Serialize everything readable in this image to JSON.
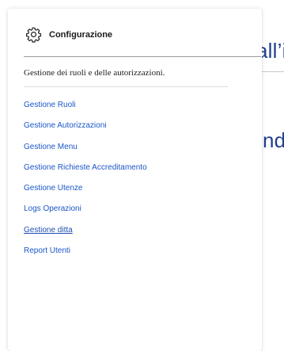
{
  "background": {
    "fragment_1": "all’i",
    "fragment_2": "indi"
  },
  "panel": {
    "icon": "gear-icon",
    "title": "Configurazione",
    "subtitle": "Gestione dei ruoli e delle autorizzazioni."
  },
  "menu": {
    "items": [
      {
        "label": "Gestione Ruoli"
      },
      {
        "label": "Gestione Autorizzazioni"
      },
      {
        "label": "Gestione Menu"
      },
      {
        "label": "Gestione Richieste Accreditamento"
      },
      {
        "label": "Gestione Utenze"
      },
      {
        "label": "Logs Operazioni"
      },
      {
        "label": "Gestione ditta"
      },
      {
        "label": "Report Utenti"
      }
    ]
  },
  "colors": {
    "link": "#1a56c9",
    "background_text": "#1f3f8f"
  }
}
